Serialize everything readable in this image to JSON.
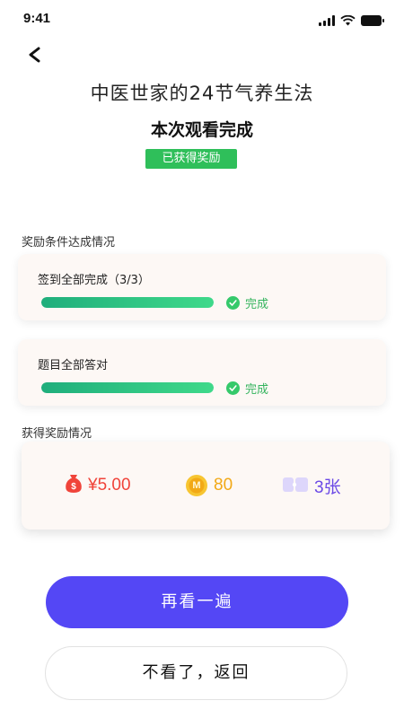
{
  "status_bar": {
    "time": "9:41"
  },
  "header": {
    "title": "中医世家的24节气养生法"
  },
  "watch_status": "本次观看完成",
  "reward_badge": "已获得奖励",
  "conditions_section": {
    "label": "奖励条件达成情况",
    "items": [
      {
        "title": "签到全部完成（3/3）",
        "progress": 1.0,
        "status": "完成"
      },
      {
        "title": "题目全部答对",
        "progress": 1.0,
        "status": "完成"
      }
    ]
  },
  "rewards_section": {
    "label": "获得奖励情况",
    "cash": "¥5.00",
    "coins": "80",
    "tickets": "3张",
    "coin_glyph": "M"
  },
  "actions": {
    "rewatch_label": "再看一遍",
    "back_label": "不看了，返回"
  },
  "colors": {
    "primary": "#5447f5",
    "success": "#35c96b",
    "cash": "#f0443a",
    "coin": "#f2a916",
    "ticket": "#6b49e6"
  },
  "icons": [
    "signal-icon",
    "wifi-icon",
    "battery-icon",
    "back-arrow-icon",
    "check-icon",
    "money-bag-icon",
    "coin-icon",
    "ticket-icon"
  ]
}
